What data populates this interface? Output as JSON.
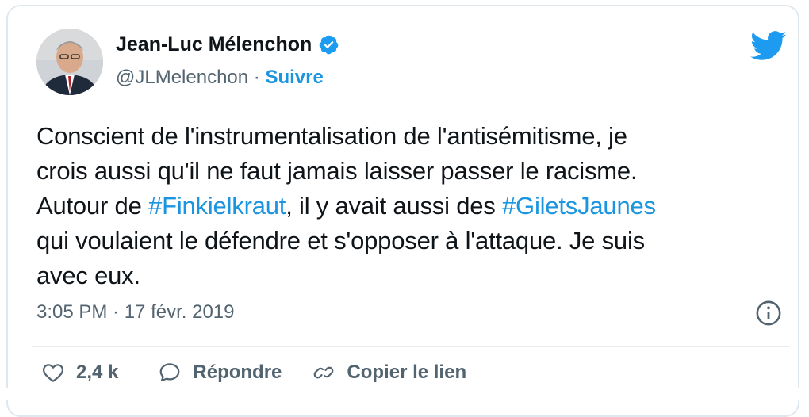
{
  "author": {
    "name": "Jean-Luc Mélenchon",
    "handle": "@JLMelenchon",
    "separator": "·",
    "follow_label": "Suivre"
  },
  "tweet": {
    "lines": [
      [
        {
          "text": "Conscient de l'instrumentalisation de l'antisémitisme, je",
          "tag": false
        }
      ],
      [
        {
          "text": "crois aussi qu'il ne faut jamais laisser passer le racisme.",
          "tag": false
        }
      ],
      [
        {
          "text": "Autour de ",
          "tag": false
        },
        {
          "text": "#Finkielkraut",
          "tag": true
        },
        {
          "text": ", il y avait aussi des ",
          "tag": false
        },
        {
          "text": "#GiletsJaunes",
          "tag": true
        }
      ],
      [
        {
          "text": "qui voulaient le défendre et s'opposer à l'attaque. Je suis",
          "tag": false
        }
      ],
      [
        {
          "text": "avec eux.",
          "tag": false
        }
      ]
    ],
    "timestamp": "3:05 PM · 17 févr. 2019"
  },
  "actions": {
    "like_count": "2,4 k",
    "reply_label": "Répondre",
    "copy_label": "Copier le lien"
  },
  "colors": {
    "link": "#1b95e0",
    "text": "#0f1419",
    "secondary": "#536471",
    "border": "#e1e8ed"
  },
  "icons": [
    "verified-badge-icon",
    "twitter-bird-icon",
    "info-icon",
    "heart-icon",
    "reply-bubble-icon",
    "link-icon"
  ]
}
